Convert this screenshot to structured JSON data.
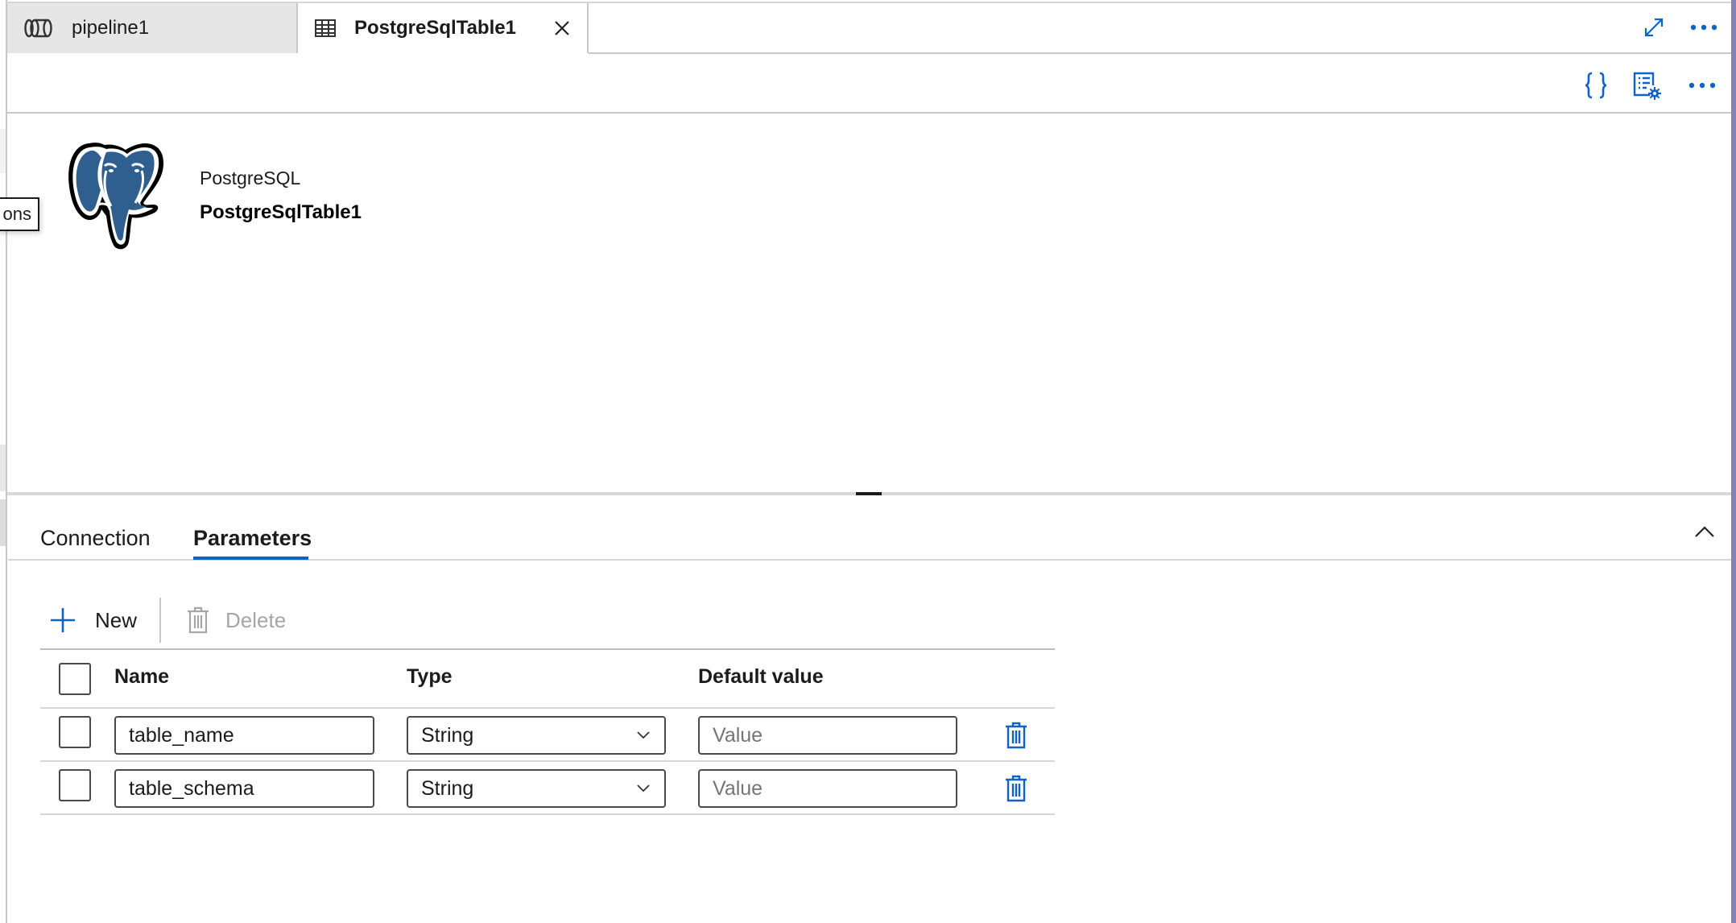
{
  "tabs": [
    {
      "label": "pipeline1",
      "icon": "pipeline-icon",
      "active": false
    },
    {
      "label": "PostgreSqlTable1",
      "icon": "table-icon",
      "active": true,
      "closable": true
    }
  ],
  "tabbar_actions": {
    "maximize": "maximize-icon",
    "more": "more-icon"
  },
  "toolbar_actions": {
    "code": "code-icon",
    "properties": "properties-icon",
    "more": "more-icon"
  },
  "header": {
    "type_label": "PostgreSQL",
    "dataset_name": "PostgreSqlTable1",
    "logo": "postgresql-elephant-logo"
  },
  "tooltip": {
    "text": "ons"
  },
  "panel": {
    "tabs": [
      {
        "label": "Connection",
        "active": false
      },
      {
        "label": "Parameters",
        "active": true
      }
    ],
    "collapse_icon": "chevron-up-icon"
  },
  "params_toolbar": {
    "new_label": "New",
    "delete_label": "Delete",
    "delete_enabled": false
  },
  "params_table": {
    "columns": [
      "Name",
      "Type",
      "Default value"
    ],
    "rows": [
      {
        "name": "table_name",
        "type": "String",
        "default_value": "",
        "default_placeholder": "Value"
      },
      {
        "name": "table_schema",
        "type": "String",
        "default_value": "",
        "default_placeholder": "Value"
      }
    ]
  },
  "colors": {
    "accent": "#0f62c9",
    "inactive_tab_bg": "#e6e6e6",
    "logo_blue": "#2f5f8f",
    "side_strip": "#8083ad"
  }
}
